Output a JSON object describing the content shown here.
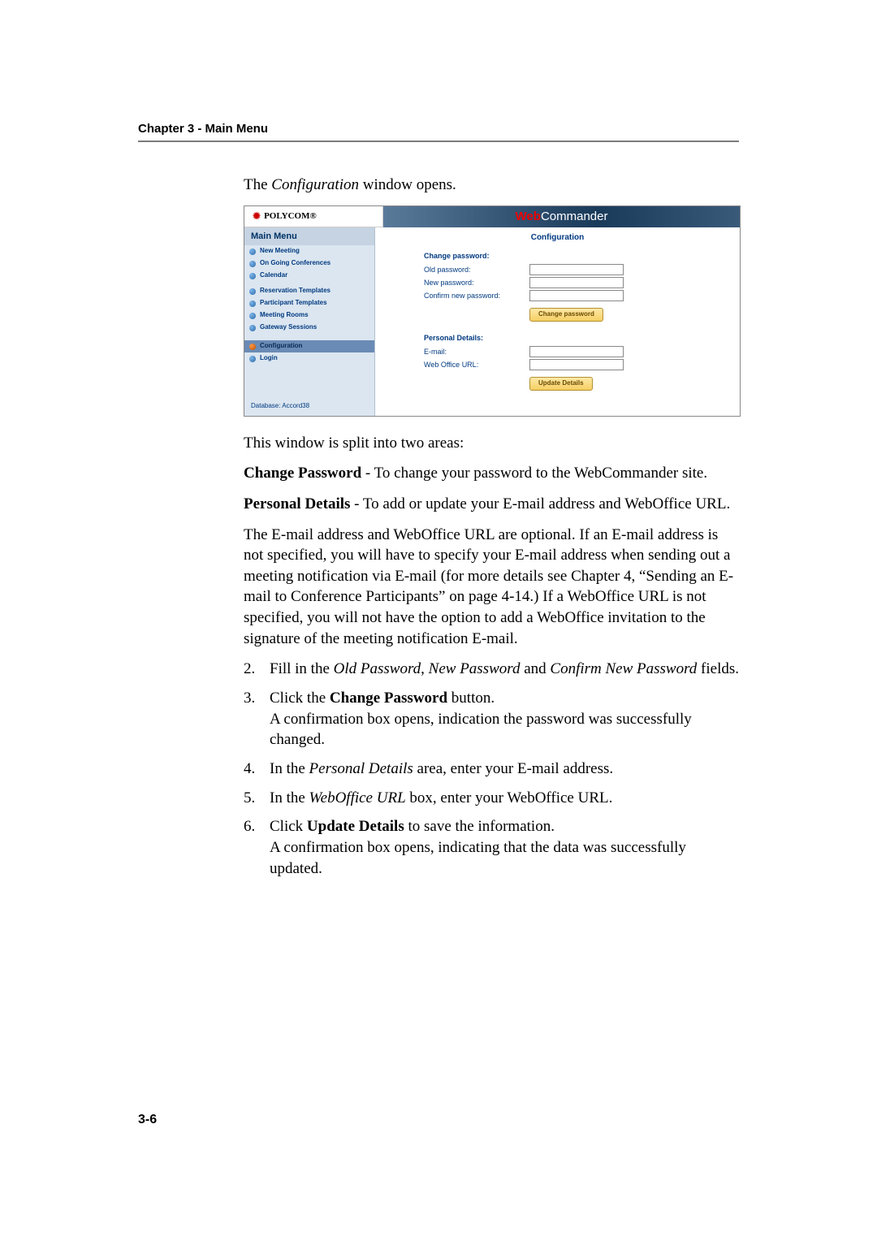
{
  "chapter_header": "Chapter 3 - Main Menu",
  "intro": {
    "pre": "The ",
    "em": "Configuration",
    "post": " window opens."
  },
  "app": {
    "brand": "POLYCOM",
    "product_pre": "Web",
    "product_post": "Commander",
    "sidebar_title": "Main Menu",
    "items": [
      {
        "label": "New Meeting"
      },
      {
        "label": "On Going Conferences"
      },
      {
        "label": "Calendar"
      },
      {
        "label": "Reservation Templates"
      },
      {
        "label": "Participant Templates"
      },
      {
        "label": "Meeting Rooms"
      },
      {
        "label": "Gateway Sessions"
      }
    ],
    "items2": [
      {
        "label": "Configuration",
        "active": true
      },
      {
        "label": "Login"
      }
    ],
    "database_label": "Database:",
    "database_value": "Accord38",
    "content_title": "Configuration",
    "change_pw_heading": "Change password:",
    "old_pw_label": "Old password:",
    "new_pw_label": "New password:",
    "confirm_pw_label": "Confirm new password:",
    "change_pw_btn": "Change password",
    "personal_heading": "Personal Details:",
    "email_label": "E-mail:",
    "weboffice_label": "Web Office URL:",
    "update_btn": "Update Details"
  },
  "body": {
    "p1": "This window is split into two areas:",
    "p2_b": "Change Password",
    "p2_rest": " - To change your password to the WebCommander site.",
    "p3_b": "Personal Details",
    "p3_rest": " - To add or update your E-mail address and WebOffice URL.",
    "p4": "The E-mail address and WebOffice URL are optional. If an E-mail address is not specified, you will have to specify your E-mail address when sending out a meeting notification via E-mail (for more details see Chapter 4, “Sending an E-mail to Conference Participants” on page 4-14.) If a WebOffice URL is not specified, you will not have the option to add a WebOffice invitation to the signature of the meeting notification E-mail.",
    "s2_num": "2.",
    "s2_a": "Fill in the ",
    "s2_i1": "Old Password",
    "s2_b": ", ",
    "s2_i2": "New Password",
    "s2_c": " and ",
    "s2_i3": "Confirm New Password",
    "s2_d": " fields.",
    "s3_num": "3.",
    "s3_a": "Click the ",
    "s3_b": "Change Password",
    "s3_c": " button.",
    "s3_d": "A confirmation box opens, indication the password was successfully changed.",
    "s4_num": "4.",
    "s4_a": "In the ",
    "s4_i": "Personal Details",
    "s4_b": " area, enter your E-mail address.",
    "s5_num": "5.",
    "s5_a": "In the ",
    "s5_i": "WebOffice URL",
    "s5_b": " box, enter your WebOffice URL.",
    "s6_num": "6.",
    "s6_a": "Click ",
    "s6_b": "Update Details",
    "s6_c": " to save the information.",
    "s6_d": "A confirmation box opens, indicating that the data was successfully updated."
  },
  "page_number": "3-6"
}
